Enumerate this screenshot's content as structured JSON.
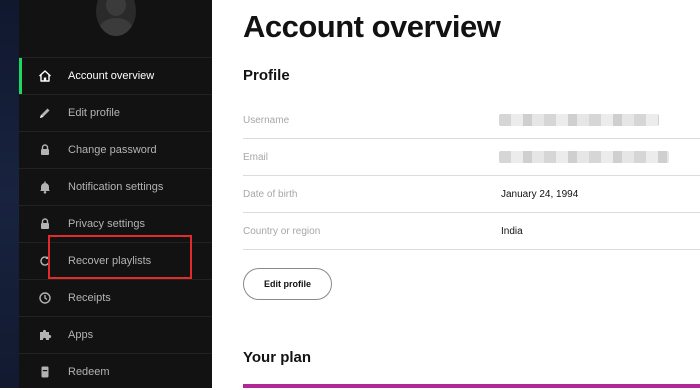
{
  "sidebar": {
    "items": [
      {
        "label": "Account overview",
        "icon": "home-icon",
        "active": true
      },
      {
        "label": "Edit profile",
        "icon": "pencil-icon"
      },
      {
        "label": "Change password",
        "icon": "lock-icon"
      },
      {
        "label": "Notification settings",
        "icon": "bell-icon"
      },
      {
        "label": "Privacy settings",
        "icon": "lock-icon"
      },
      {
        "label": "Recover playlists",
        "icon": "refresh-icon",
        "highlighted": true
      },
      {
        "label": "Receipts",
        "icon": "clock-icon"
      },
      {
        "label": "Apps",
        "icon": "puzzle-icon"
      },
      {
        "label": "Redeem",
        "icon": "device-icon"
      }
    ]
  },
  "main": {
    "title": "Account overview",
    "profile": {
      "heading": "Profile",
      "rows": [
        {
          "label": "Username",
          "value": "",
          "redacted": true
        },
        {
          "label": "Email",
          "value": "",
          "redacted": true
        },
        {
          "label": "Date of birth",
          "value": "January 24, 1994"
        },
        {
          "label": "Country or region",
          "value": "India"
        }
      ],
      "edit_button": "Edit profile"
    },
    "plan": {
      "heading": "Your plan"
    }
  },
  "colors": {
    "sidebar_bg": "#121212",
    "active_accent": "#1ed760",
    "highlight_box": "#e32b2b",
    "plan_accent": "#af2896"
  }
}
